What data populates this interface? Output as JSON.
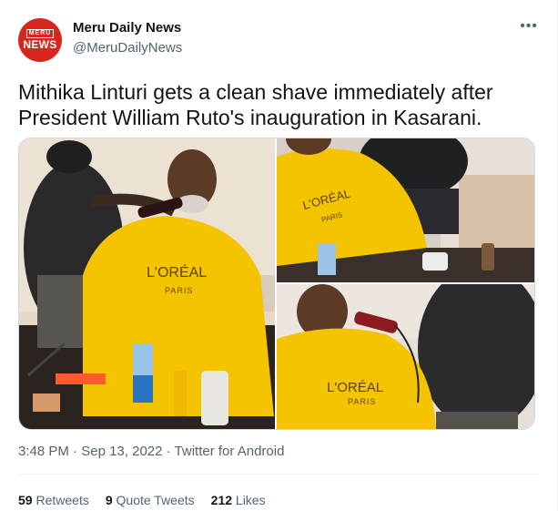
{
  "account": {
    "logo_top": "MERU",
    "logo_main": "NEWS",
    "name": "Meru Daily News",
    "handle": "@MeruDailyNews"
  },
  "more_icon": "more-horizontal-icon",
  "tweet": {
    "text": "Mithika Linturi gets a clean shave immediately after President William Ruto's inauguration in Kasarani.",
    "photos": [
      {
        "name": "photo-1",
        "cape_text_1": "L'ORÉAL",
        "cape_text_2": "PARIS"
      },
      {
        "name": "photo-2",
        "cape_text_1": "L'ORÉAL",
        "cape_text_2": "PARIS"
      },
      {
        "name": "photo-3",
        "cape_text_1": "L'ORÉAL",
        "cape_text_2": "PARIS"
      }
    ]
  },
  "meta": {
    "time": "3:48 PM",
    "sep": " · ",
    "date": "Sep 13, 2022",
    "source": "Twitter for Android"
  },
  "stats": {
    "retweets_count": "59",
    "retweets_label": "Retweets",
    "quotes_count": "9",
    "quotes_label": "Quote Tweets",
    "likes_count": "212",
    "likes_label": "Likes"
  },
  "colors": {
    "brand_red": "#d7261e",
    "cape_yellow": "#f5c400",
    "text_secondary": "#536471"
  }
}
